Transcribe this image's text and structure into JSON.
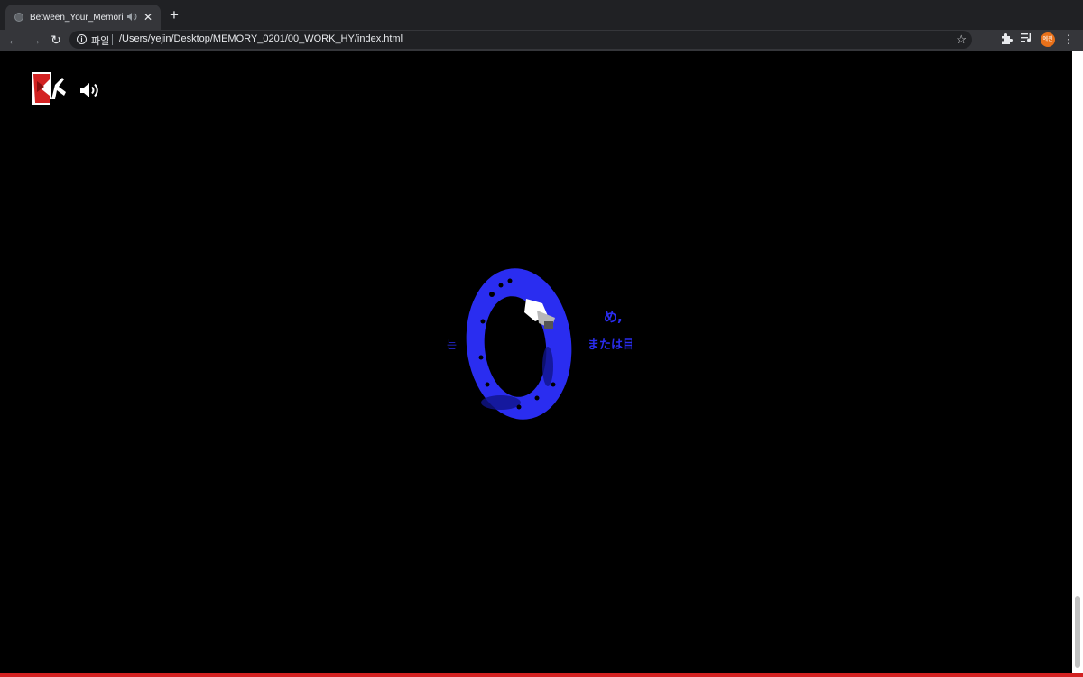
{
  "browser": {
    "tab": {
      "title": "Between_Your_Memories",
      "audio_icon": "speaker-icon",
      "close_glyph": "✕"
    },
    "new_tab_glyph": "+",
    "toolbar": {
      "back_glyph": "←",
      "forward_glyph": "→",
      "reload_glyph": "↻",
      "scheme_label": "파일",
      "url": "/Users/yejin/Desktop/MEMORY_0201/00_WORK_HY/index.html",
      "bookmark_glyph": "☆",
      "profile_label": "예진",
      "menu_glyph": "⋮"
    }
  },
  "page": {
    "background": "#000000",
    "accent_blue": "#2a2df0",
    "accent_red": "#d32222",
    "visual_text": {
      "line1": "め,",
      "line2": "または目",
      "side": "는"
    }
  }
}
